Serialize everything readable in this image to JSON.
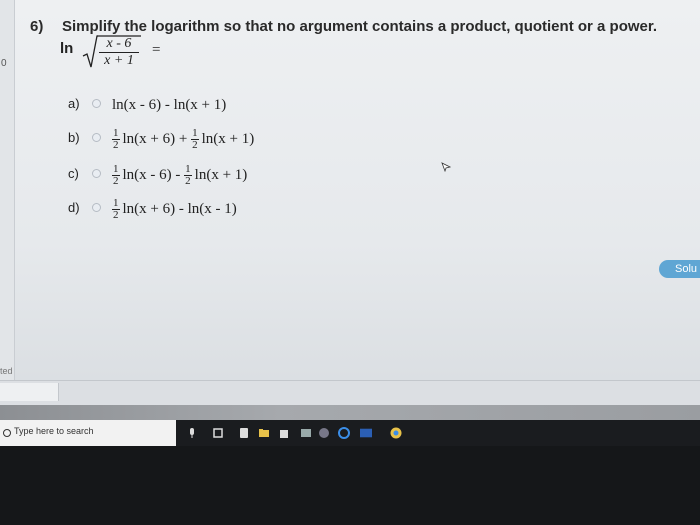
{
  "question": {
    "number": "6)",
    "prompt": "Simplify the logarithm so that no argument contains a product, quotient or a power.",
    "expr_fn": "ln",
    "expr_numerator": "x - 6",
    "expr_denominator": "x + 1",
    "expr_equals": "="
  },
  "options": [
    {
      "letter": "a)",
      "text": "ln(x - 6) - ln(x + 1)"
    },
    {
      "letter": "b)",
      "coef1": [
        "1",
        "2"
      ],
      "term1": "ln(x + 6) +",
      "coef2": [
        "1",
        "2"
      ],
      "term2": "ln(x + 1)"
    },
    {
      "letter": "c)",
      "coef1": [
        "1",
        "2"
      ],
      "term1": "ln(x - 6) -",
      "coef2": [
        "1",
        "2"
      ],
      "term2": "ln(x + 1)"
    },
    {
      "letter": "d)",
      "coef1": [
        "1",
        "2"
      ],
      "term1": "ln(x + 6) - ln(x - 1)"
    }
  ],
  "sidebar": {
    "number": "0",
    "status": "ted"
  },
  "solution_button": "Solu",
  "taskbar": {
    "search_placeholder": "Type here to search"
  },
  "colors": {
    "accent": "#5fa6d4",
    "page": "#eef0f2",
    "taskbar": "#1a1c1f"
  }
}
